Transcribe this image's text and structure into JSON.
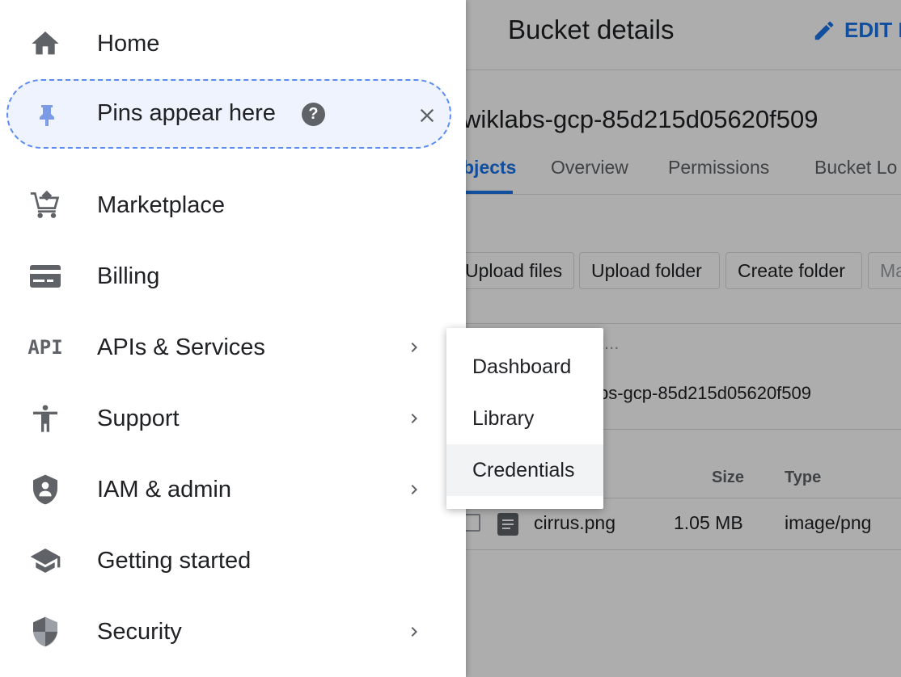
{
  "background": {
    "page_title": "Bucket details",
    "edit_label": "EDIT E",
    "bucket_name": "wiklabs-gcp-85d215d05620f509",
    "tabs": [
      {
        "label": "bjects"
      },
      {
        "label": "Overview"
      },
      {
        "label": "Permissions"
      },
      {
        "label": "Bucket Lo"
      }
    ],
    "buttons": {
      "upload_files": "Upload files",
      "upload_folder": "Upload folder",
      "create_folder": "Create folder",
      "manage": "Ma"
    },
    "filter_placeholder": "x...",
    "path": "ps-gcp-85d215d05620f509",
    "table": {
      "headers": {
        "size": "Size",
        "type": "Type"
      },
      "rows": [
        {
          "name": "cirrus.png",
          "size": "1.05 MB",
          "type": "image/png"
        }
      ]
    }
  },
  "nav": {
    "home": "Home",
    "pins": "Pins appear here",
    "marketplace": "Marketplace",
    "billing": "Billing",
    "apis": "APIs & Services",
    "apis_icon_text": "API",
    "support": "Support",
    "iam": "IAM & admin",
    "getting_started": "Getting started",
    "security": "Security"
  },
  "submenu": {
    "items": [
      {
        "label": "Dashboard"
      },
      {
        "label": "Library"
      },
      {
        "label": "Credentials"
      }
    ],
    "highlighted": "Credentials"
  },
  "colors": {
    "accent": "#1a73e8",
    "icon_gray": "#5f6368",
    "pin_blue": "#7b9be6",
    "pins_bg": "#eef3fd"
  }
}
